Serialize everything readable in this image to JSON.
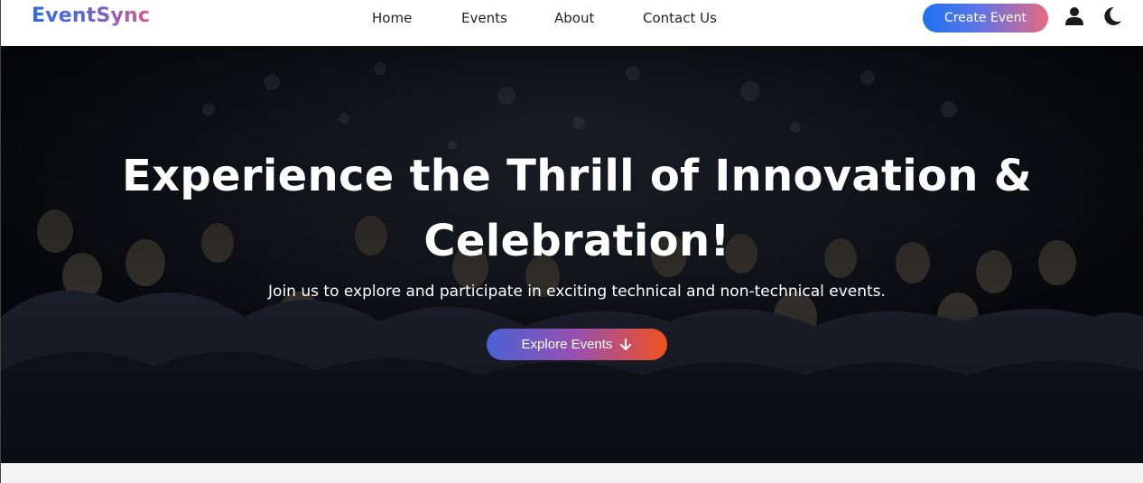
{
  "brand": {
    "name": "EventSync"
  },
  "nav": {
    "links": [
      "Home",
      "Events",
      "About",
      "Contact Us"
    ],
    "create_label": "Create Event",
    "icons": [
      "user-icon",
      "moon-icon"
    ]
  },
  "hero": {
    "title_line1": "Experience the Thrill of Innovation &",
    "title_line2": "Celebration!",
    "subtitle": "Join us to explore and participate in exciting technical and non-technical events.",
    "cta_label": "Explore Events",
    "cta_icon": "arrow-down-icon"
  },
  "colors": {
    "brand_gradient": [
      "#2f6fe0",
      "#e05a8a"
    ],
    "create_gradient": [
      "#1d73f0",
      "#e86a7e"
    ],
    "cta_gradient": [
      "#4a62d6",
      "#f0521e"
    ]
  }
}
